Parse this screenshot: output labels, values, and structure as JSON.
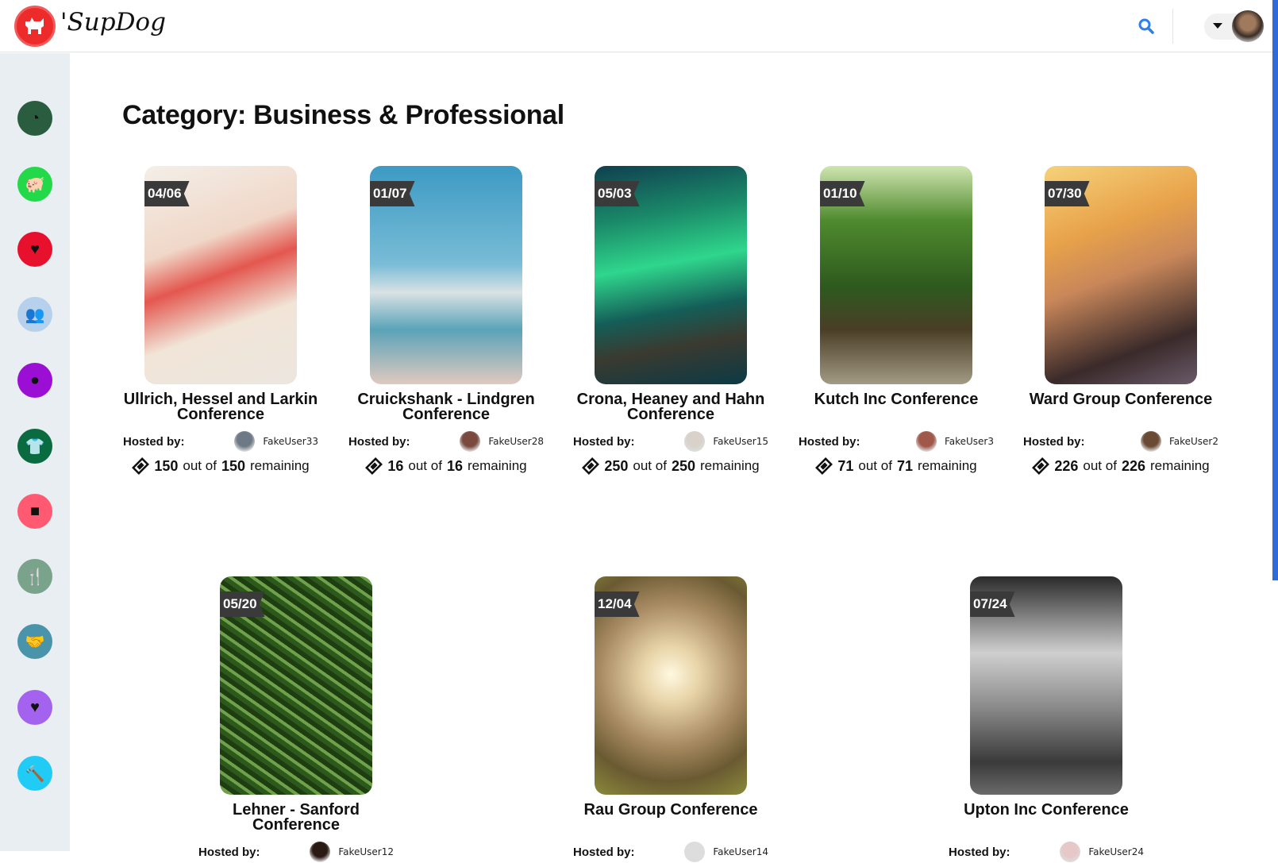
{
  "header": {
    "logo_text": "'SupDog",
    "search_icon": "search-icon",
    "menu_icon": "caret-down-icon"
  },
  "sidebar": {
    "items": [
      {
        "icon": "dashboard-icon",
        "color": "#2a5d3f",
        "glyph": "◔"
      },
      {
        "icon": "piggy-bank-icon",
        "color": "#23d94a",
        "glyph": "🐖"
      },
      {
        "icon": "hand-holding-heart-icon",
        "color": "#e8112d",
        "glyph": "♥"
      },
      {
        "icon": "users-icon",
        "color": "#b7d0ec",
        "glyph": "👥"
      },
      {
        "icon": "apple-icon",
        "color": "#9b0fd4",
        "glyph": "●"
      },
      {
        "icon": "tshirt-icon",
        "color": "#0a6a40",
        "glyph": "👕"
      },
      {
        "icon": "video-icon",
        "color": "#ff5a72",
        "glyph": "■"
      },
      {
        "icon": "utensils-icon",
        "color": "#7aa38c",
        "glyph": "🍴"
      },
      {
        "icon": "handshake-icon",
        "color": "#4994ab",
        "glyph": "🤝"
      },
      {
        "icon": "heart-icon",
        "color": "#a463ef",
        "glyph": "♥"
      },
      {
        "icon": "hammer-icon",
        "color": "#20ccf5",
        "glyph": "🔨"
      }
    ]
  },
  "page": {
    "title": "Category: Business & Professional",
    "hosted_label": "Hosted by:",
    "out_of": "out of",
    "remaining": "remaining"
  },
  "events": [
    {
      "date": "04/06",
      "title": "Ullrich, Hessel and Larkin Conference",
      "host": "FakeUser33",
      "remaining": "150",
      "total": "150",
      "img": "linear-gradient(160deg,#f4efe8 0%,#f0d7c8 35%,#e3574f 50%,#f1e5d7 70%,#ece6df 100%)",
      "av": "#6d7a86"
    },
    {
      "date": "01/07",
      "title": "Cruickshank - Lindgren Conference",
      "host": "FakeUser28",
      "remaining": "16",
      "total": "16",
      "img": "linear-gradient(180deg,#3c9ac4 0%,#79bcd6 45%,#d9e2e4 58%,#5aa3b8 75%,#e0c9c0 100%)",
      "av": "#7a4a3f"
    },
    {
      "date": "05/03",
      "title": "Crona, Heaney and Hahn Conference",
      "host": "FakeUser15",
      "remaining": "250",
      "total": "250",
      "img": "linear-gradient(170deg,#0f3f4f 0%,#1b8c6a 25%,#2fd68c 45%,#145e58 65%,#3a3a30 80%,#0c3a45 100%)",
      "av": "#d8d2ca"
    },
    {
      "date": "01/10",
      "title": "Kutch Inc Conference",
      "host": "FakeUser3",
      "remaining": "71",
      "total": "71",
      "img": "linear-gradient(180deg,#cfe5b0 0%,#4f8a2e 25%,#2e5a1e 55%,#4a3e26 75%,#a39b84 100%)",
      "av": "#a0584a"
    },
    {
      "date": "07/30",
      "title": "Ward Group Conference",
      "host": "FakeUser2",
      "remaining": "226",
      "total": "226",
      "img": "linear-gradient(160deg,#f5d27a 0%,#e8a24a 30%,#c9875a 50%,#3a2a2a 80%,#6a5a6a 100%)",
      "av": "#6a4a34"
    },
    {
      "date": "05/20",
      "title": "Lehner - Sanford Conference",
      "host": "FakeUser12",
      "img": "repeating-linear-gradient(35deg,#2d5a1c 0 6px,#6fa04a 6px 10px,#1e3e12 10px 16px)",
      "av": "#2a1a14"
    },
    {
      "date": "12/04",
      "title": "Rau Group Conference",
      "host": "FakeUser14",
      "img": "radial-gradient(circle at 50% 45%,#fff8e0 0%,#e8d4a8 20%,#a88a62 50%,#6a5a32 75%,#8a8a3a 100%)",
      "av": "#ddd"
    },
    {
      "date": "07/24",
      "title": "Upton Inc Conference",
      "host": "FakeUser24",
      "img": "linear-gradient(180deg,#2a2a2a 0%,#cfcfcf 35%,#8a8a8a 60%,#3a3a3a 85%,#6a6a6a 100%)",
      "av": "#e6c8c8"
    }
  ]
}
